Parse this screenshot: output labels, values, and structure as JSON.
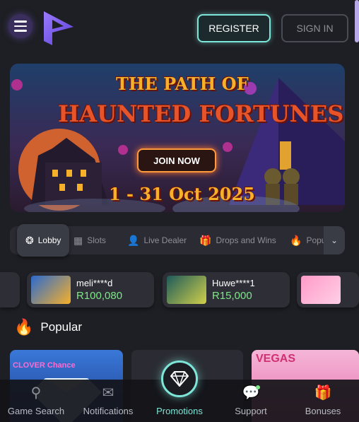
{
  "header": {
    "register_label": "REGISTER",
    "signin_label": "SIGN IN",
    "accent": "#7ee6d8"
  },
  "banner": {
    "title_line1": "THE PATH OF",
    "title_line2": "HAUNTED FORTUNES",
    "cta_label": "JOIN NOW",
    "dates": "1 - 31 Oct 2025"
  },
  "categories": [
    {
      "label": "Lobby",
      "icon": "lobby-icon"
    },
    {
      "label": "Slots",
      "icon": "slots-icon"
    },
    {
      "label": "Live Dealer",
      "icon": "live-dealer-icon"
    },
    {
      "label": "Drops and Wins",
      "icon": "gift-icon"
    },
    {
      "label": "Popu",
      "icon": "flame-icon"
    }
  ],
  "winners": [
    {
      "name": "meli****d",
      "amount": "R100,080"
    },
    {
      "name": "Huwe****1",
      "amount": "R15,000"
    }
  ],
  "popular": {
    "title": "Popular",
    "game1_label": "CLOVER Chance",
    "game3_label": "VEGAS"
  },
  "bottom_nav": {
    "search": "Game Search",
    "notifications": "Notifications",
    "promotions": "Promotions",
    "support": "Support",
    "bonuses": "Bonuses"
  }
}
